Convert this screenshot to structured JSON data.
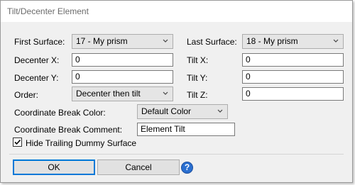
{
  "window": {
    "title": "Tilt/Decenter Element"
  },
  "fields": {
    "first_surface": {
      "label": "First Surface:",
      "value": "17 - My prism"
    },
    "last_surface": {
      "label": "Last Surface:",
      "value": "18 - My prism"
    },
    "decenter_x": {
      "label": "Decenter X:",
      "value": "0"
    },
    "decenter_y": {
      "label": "Decenter Y:",
      "value": "0"
    },
    "tilt_x": {
      "label": "Tilt X:",
      "value": "0"
    },
    "tilt_y": {
      "label": "Tilt Y:",
      "value": "0"
    },
    "tilt_z": {
      "label": "Tilt Z:",
      "value": "0"
    },
    "order": {
      "label": "Order:",
      "value": "Decenter then tilt"
    },
    "cb_color": {
      "label": "Coordinate Break Color:",
      "value": "Default Color"
    },
    "cb_comment": {
      "label": "Coordinate Break Comment:",
      "value": "Element Tilt"
    }
  },
  "options": {
    "hide_trailing_dummy": {
      "label": "Hide Trailing Dummy Surface",
      "checked": true
    }
  },
  "buttons": {
    "ok": "OK",
    "cancel": "Cancel",
    "help": "?"
  }
}
